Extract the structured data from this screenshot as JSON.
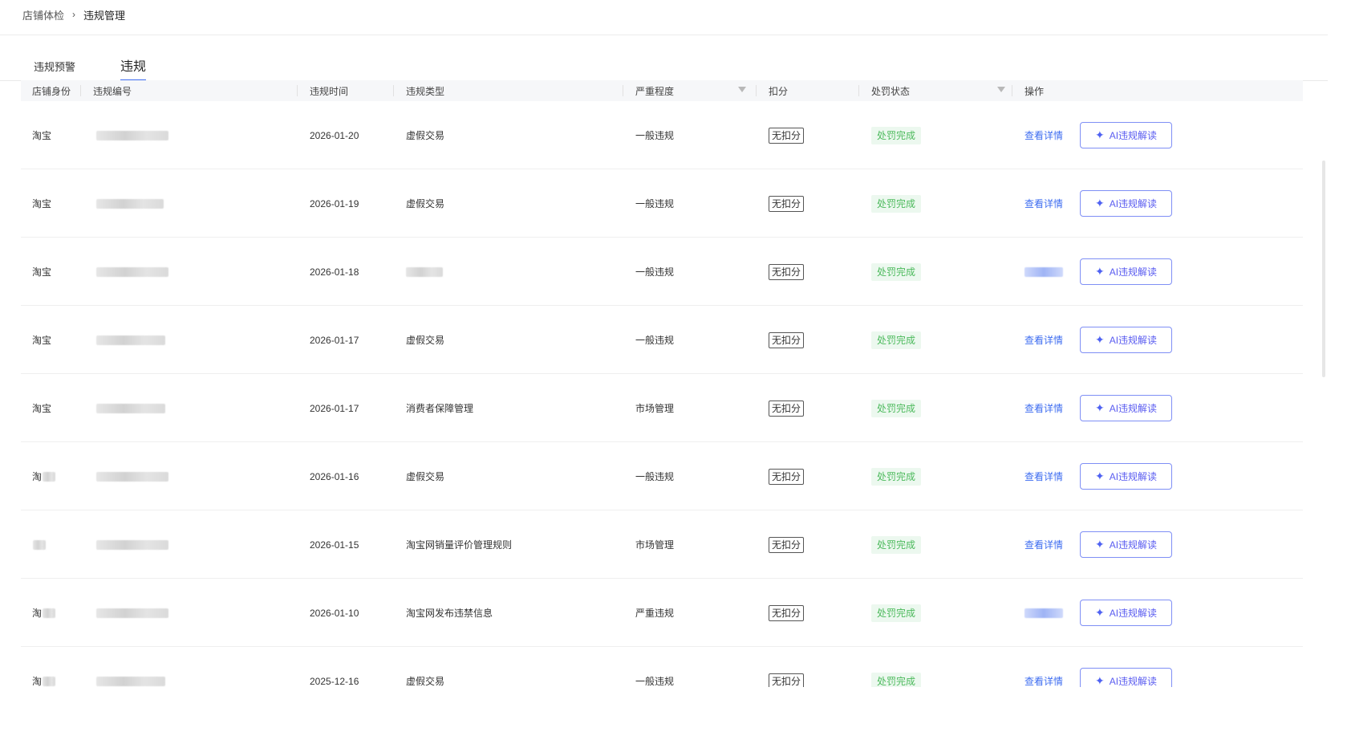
{
  "breadcrumb": {
    "parent": "店铺体检",
    "separator": "›",
    "current": "违规管理"
  },
  "tabs": [
    {
      "label": "违规预警",
      "active": false
    },
    {
      "label": "违规",
      "active": true
    }
  ],
  "table": {
    "headers": [
      "店铺身份",
      "违规编号",
      "违规时间",
      "违规类型",
      "严重程度",
      "扣分",
      "处罚状态",
      "操作"
    ],
    "rows": [
      {
        "shop": "淘宝",
        "time": "2026-01-20",
        "type": "虚假交易",
        "severity": "一般违规",
        "score": "无扣分",
        "status": "处罚完成",
        "detail": "查看详情",
        "ai": "AI违规解读"
      },
      {
        "shop": "淘宝",
        "time": "2026-01-19",
        "type": "虚假交易",
        "severity": "一般违规",
        "score": "无扣分",
        "status": "处罚完成",
        "detail": "查看详情",
        "ai": "AI违规解读"
      },
      {
        "shop": "淘宝",
        "time": "2026-01-18",
        "type": "",
        "severity": "一般违规",
        "score": "无扣分",
        "status": "处罚完成",
        "detail": "",
        "ai": "AI违规解读"
      },
      {
        "shop": "淘宝",
        "time": "2026-01-17",
        "type": "虚假交易",
        "severity": "一般违规",
        "score": "无扣分",
        "status": "处罚完成",
        "detail": "查看详情",
        "ai": "AI违规解读"
      },
      {
        "shop": "淘宝",
        "time": "2026-01-17",
        "type": "消费者保障管理",
        "severity": "市场管理",
        "score": "无扣分",
        "status": "处罚完成",
        "detail": "查看详情",
        "ai": "AI违规解读"
      },
      {
        "shop": "淘",
        "time": "2026-01-16",
        "type": "虚假交易",
        "severity": "一般违规",
        "score": "无扣分",
        "status": "处罚完成",
        "detail": "查看详情",
        "ai": "AI违规解读"
      },
      {
        "shop": "",
        "time": "2026-01-15",
        "type": "淘宝网销量评价管理规则",
        "severity": "市场管理",
        "score": "无扣分",
        "status": "处罚完成",
        "detail": "查看详情",
        "ai": "AI违规解读"
      },
      {
        "shop": "淘",
        "time": "2026-01-10",
        "type": "淘宝网发布违禁信息",
        "severity": "严重违规",
        "score": "无扣分",
        "status": "处罚完成",
        "detail": "",
        "ai": "AI违规解读"
      },
      {
        "shop": "淘",
        "time": "2025-12-16",
        "type": "虚假交易",
        "severity": "一般违规",
        "score": "无扣分",
        "status": "处罚完成",
        "detail": "查看详情",
        "ai": "AI违规解读"
      }
    ]
  },
  "colors": {
    "accent": "#3d6cf0",
    "status_green": "#4cba5c",
    "ai_purple": "#5a5cf0"
  }
}
